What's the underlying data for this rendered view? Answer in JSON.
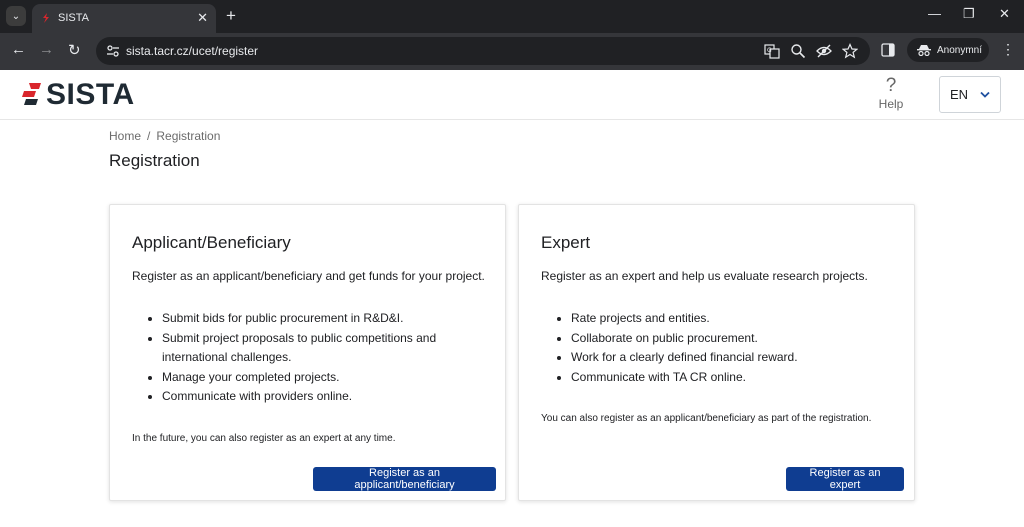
{
  "browser": {
    "tab_title": "SISTA",
    "url": "sista.tacr.cz/ucet/register",
    "profile_label": "Anonymní"
  },
  "header": {
    "logo_text": "SISTA",
    "help_label": "Help",
    "language": "EN"
  },
  "breadcrumb": {
    "home": "Home",
    "separator": "/",
    "current": "Registration"
  },
  "page_title": "Registration",
  "cards": [
    {
      "title": "Applicant/Beneficiary",
      "description": "Register as an applicant/beneficiary and get funds for your project.",
      "items": [
        "Submit bids for public procurement in R&D&I.",
        "Submit project proposals to public competitions and international challenges.",
        "Manage your completed projects.",
        "Communicate with providers online."
      ],
      "note": "In the future, you can also register as an expert at any time.",
      "button_label": "Register as an applicant/beneficiary"
    },
    {
      "title": "Expert",
      "description": "Register as an expert and help us evaluate research projects.",
      "items": [
        "Rate projects and entities.",
        "Collaborate on public procurement.",
        "Work for a clearly defined financial reward.",
        "Communicate with TA CR online."
      ],
      "note": "You can also register as an applicant/beneficiary as part of the registration.",
      "button_label": "Register as an expert"
    }
  ],
  "colors": {
    "brand_red": "#d9262c",
    "button_blue": "#0f3d91",
    "chrome_dark": "#202124",
    "chrome_toolbar": "#35363a"
  }
}
